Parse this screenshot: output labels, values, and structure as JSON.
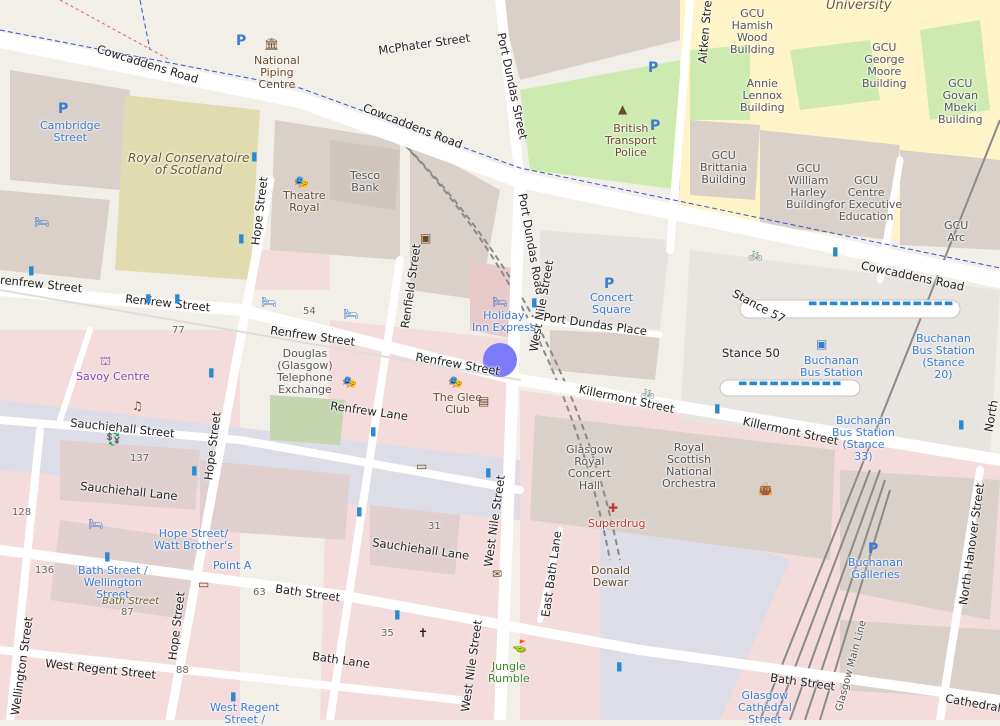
{
  "map": {
    "location_marker": {
      "color": "#7b7bfc"
    },
    "streets": {
      "cowcaddens_road_1": "Cowcaddens Road",
      "cowcaddens_road_2": "Cowcaddens Road",
      "cowcaddens_road_3": "Cowcaddens Road",
      "mcphater_street": "McPhater Street",
      "port_dundas_street": "Port Dundas Street",
      "port_dundas_road": "Port Dundas Road",
      "aitken_street": "Aitken Street",
      "hope_street_1": "Hope Street",
      "hope_street_2": "Hope Street",
      "hope_street_3": "Hope Street",
      "renfrew_street_1": "renfrew Street",
      "renfrew_street_2": "Renfrew Street",
      "renfrew_street_3": "Renfrew Street",
      "renfrew_street_4": "Renfrew Street",
      "renfield_street": "Renfield Street",
      "renfrew_lane": "Renfrew Lane",
      "west_nile_street_1": "West Nile Street",
      "west_nile_street_2": "West Nile Street",
      "west_nile_street_3": "West Nile Street",
      "port_dundas_place": "Port Dundas Place",
      "killermont_street_1": "Killermont Street",
      "killermont_street_2": "Killermont Street",
      "sauchiehall_street_1": "Sauchiehall Street",
      "sauchiehall_street_2": "Sauchiehall Street",
      "sauchiehall_lane_1": "Sauchiehall Lane",
      "sauchiehall_lane_2": "Sauchiehall Lane",
      "bath_street_1": "Bath Street",
      "bath_street_2": "Bath Street",
      "bath_lane": "Bath Lane",
      "east_bath_lane": "East Bath Lane",
      "west_regent_street": "West Regent Street",
      "wellington_street": "Wellington Street",
      "north_hanover_street": "North Hanover Street",
      "cathedral": "Cathedral",
      "north": "North",
      "glasgow_main_line": "Glasgow Main Line",
      "stance_57": "Stance 57",
      "stance_50": "Stance 50"
    },
    "places": {
      "university": "University",
      "hamish_wood": "GCU\nHamish\nWood\nBuilding",
      "annie_lennox": "Annie\nLennox\nBuilding",
      "george_moore": "GCU\nGeorge\nMoore\nBuilding",
      "govan_mbeki": "GCU\nGovan\nMbeki\nBuilding",
      "brittania": "GCU\nBrittania\nBuilding",
      "william_harley": "GCU\nWilliam\nHarley\nBuilding",
      "centre_exec": "GCU\nCentre\nfor Executive\nEducation",
      "gcu_arc": "GCU\nArc",
      "national_piping": "National\nPiping\nCentre",
      "cambridge_street": "Cambridge\nStreet",
      "royal_conservatoire": "Royal Conservatoire\nof Scotland",
      "theatre_royal": "Theatre\nRoyal",
      "tesco_bank": "Tesco\nBank",
      "british_transport_police": "British\nTransport\nPolice",
      "holiday_inn": "Holiday\nInn Express",
      "concert_square": "Concert\nSquare",
      "buchanan_bus_station": "Buchanan\nBus Station",
      "buchanan_stance_20": "Buchanan\nBus Station\n(Stance\n20)",
      "buchanan_stance_33": "Buchanan\nBus Station\n(Stance\n33)",
      "savoy_centre": "Savoy Centre",
      "douglas_exchange": "Douglas\n(Glasgow)\nTelephone\nExchange",
      "glee_club": "The Glee\nClub",
      "concert_hall": "Glasgow\nRoyal\nConcert\nHall",
      "rsno": "Royal\nScottish\nNational\nOrchestra",
      "superdrug": "Superdrug",
      "donald_dewar": "Donald\nDewar",
      "hope_watt": "Hope Street/\nWatt Brother's",
      "point_a": "Point A",
      "bath_wellington": "Bath Street /\nWellington\nStreet",
      "bath_street_stop": "Bath Street",
      "buchanan_galleries": "Buchanan\nGalleries",
      "jungle_rumble": "Jungle\nRumble",
      "glasgow_cathedral_street": "Glasgow\nCathedral\nStreet",
      "west_regent_stop": "West Regent\nStreet /"
    },
    "house_numbers": {
      "n54": "54",
      "n77": "77",
      "n137": "137",
      "n128": "128",
      "n31": "31",
      "n136": "136",
      "n87": "87",
      "n63": "63",
      "n35": "35",
      "n88": "88"
    },
    "colors": {
      "background": "#f2efe9",
      "building": "#d9d0c9",
      "pedestrian": "#dddde8",
      "university": "#fff4c8",
      "park": "#cdebb0",
      "retail": "#f5dcdc",
      "road": "#ffffff",
      "bus_stop": "#2a8ad0",
      "tram_rail": "#8a8a8a"
    }
  }
}
